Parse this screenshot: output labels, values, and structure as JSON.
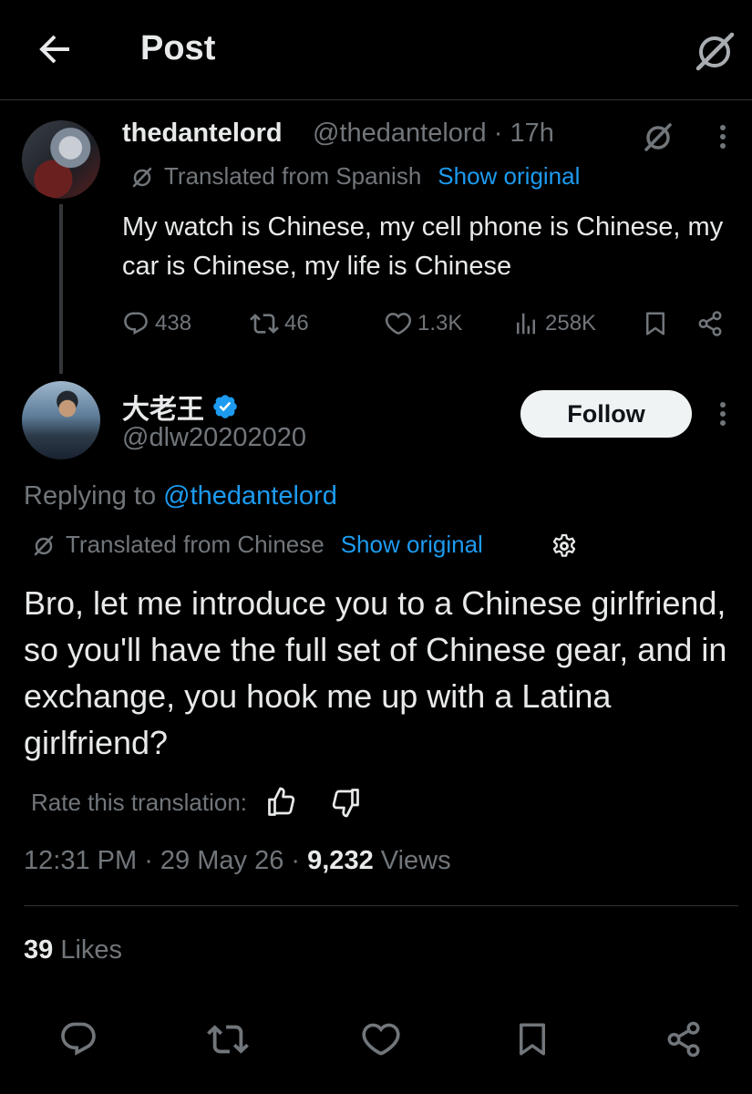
{
  "header": {
    "title": "Post",
    "back_icon": "arrow-left-icon",
    "grok_icon": "grok-icon"
  },
  "parent_tweet": {
    "display_name": "thedantelord",
    "handle_time": "@thedantelord · 17h",
    "translated_label": "Translated from Spanish",
    "show_original": "Show original",
    "text": "My watch is Chinese, my cell phone is Chinese, my car is Chinese, my life is Chinese",
    "replies": "438",
    "reposts": "46",
    "likes": "1.3K",
    "views": "258K"
  },
  "main_tweet": {
    "display_name": "大老王",
    "verified": true,
    "handle": "@dlw20202020",
    "follow_label": "Follow",
    "replying_prefix": "Replying to ",
    "replying_to": "@thedantelord",
    "translated_label": "Translated from Chinese",
    "show_original": "Show original",
    "text": "Bro, let me introduce you to a Chinese girlfriend, so you'll have the full set of Chinese gear, and in exchange, you hook me up with a Latina girlfriend?",
    "rate_label": "Rate this translation:",
    "time": "12:31 PM",
    "date": "29 May 26",
    "views_count": "9,232",
    "views_label": "Views",
    "likes_count": "39",
    "likes_label": "Likes"
  },
  "colors": {
    "background": "#000000",
    "text": "#e7e9ea",
    "muted": "#71767b",
    "accent": "#1d9bf0",
    "divider": "#2f3336"
  }
}
